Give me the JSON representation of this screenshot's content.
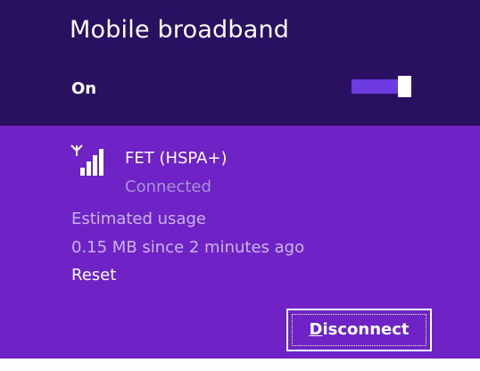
{
  "panel": {
    "title": "Mobile broadband",
    "toggle": {
      "label": "On",
      "state": "on"
    }
  },
  "network": {
    "icon": "signal-bars-icon",
    "name": "FET (HSPA+)",
    "status": "Connected",
    "usage_label": "Estimated usage",
    "usage_value": "0.15 MB since 2 minutes ago",
    "reset_label": "Reset",
    "disconnect_button": {
      "label": "Disconnect",
      "accel_char": "D",
      "label_rest": "isconnect"
    }
  },
  "colors": {
    "header_bg": "#2a1060",
    "panel_bg": "#6f22c6",
    "toggle_track": "#6d3ce0",
    "secondary_text": "#a992d7"
  }
}
